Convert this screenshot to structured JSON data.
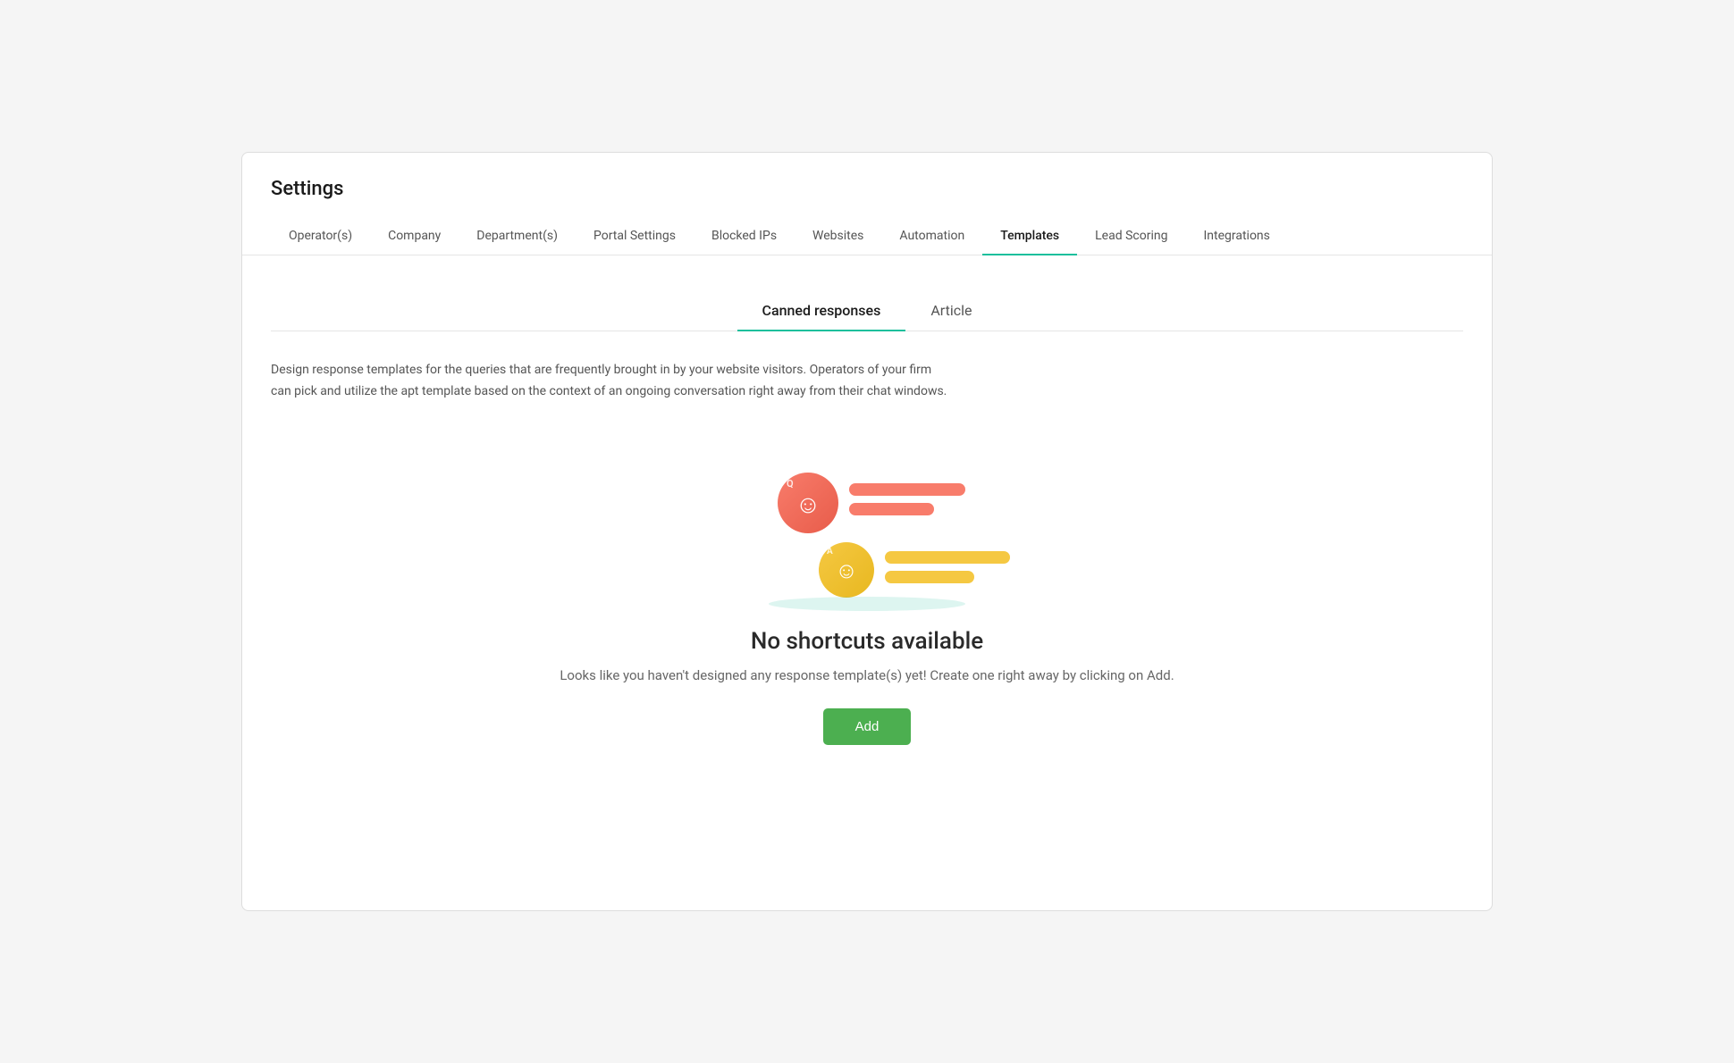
{
  "page": {
    "title": "Settings"
  },
  "nav": {
    "tabs": [
      {
        "id": "operators",
        "label": "Operator(s)",
        "active": false
      },
      {
        "id": "company",
        "label": "Company",
        "active": false
      },
      {
        "id": "departments",
        "label": "Department(s)",
        "active": false
      },
      {
        "id": "portal-settings",
        "label": "Portal Settings",
        "active": false
      },
      {
        "id": "blocked-ips",
        "label": "Blocked IPs",
        "active": false
      },
      {
        "id": "websites",
        "label": "Websites",
        "active": false
      },
      {
        "id": "automation",
        "label": "Automation",
        "active": false
      },
      {
        "id": "templates",
        "label": "Templates",
        "active": true
      },
      {
        "id": "lead-scoring",
        "label": "Lead Scoring",
        "active": false
      },
      {
        "id": "integrations",
        "label": "Integrations",
        "active": false
      }
    ]
  },
  "sub_tabs": {
    "tabs": [
      {
        "id": "canned-responses",
        "label": "Canned responses",
        "active": true
      },
      {
        "id": "article",
        "label": "Article",
        "active": false
      }
    ]
  },
  "content": {
    "description": "Design response templates for the queries that are frequently brought in by your website visitors. Operators of your firm can pick and utilize the apt template based on the context of an ongoing conversation right away from their chat windows.",
    "empty_state": {
      "title": "No shortcuts available",
      "description": "Looks like you haven't designed any response template(s) yet! Create one right away by clicking on Add.",
      "add_button_label": "Add"
    }
  }
}
